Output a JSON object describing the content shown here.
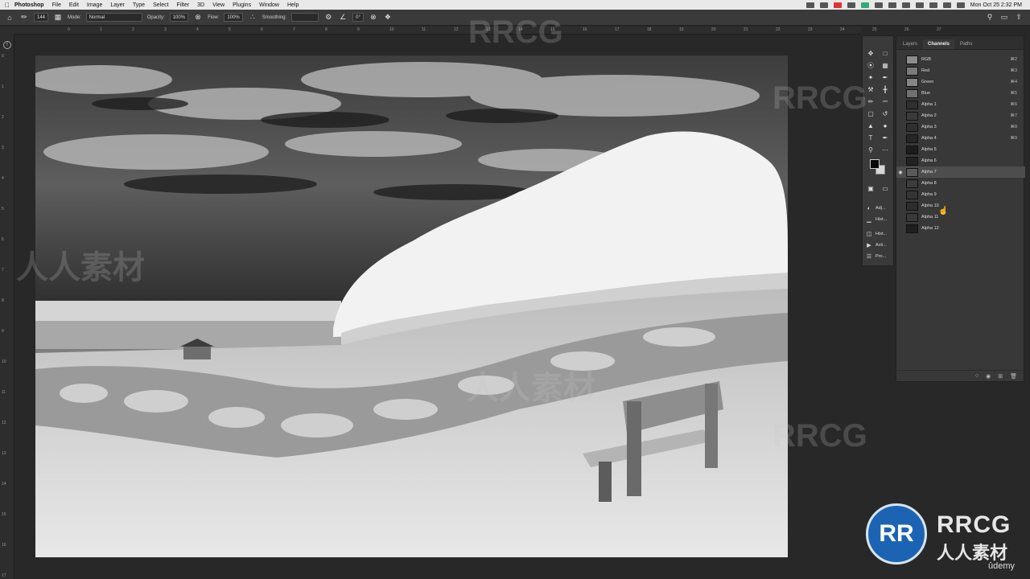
{
  "menubar": {
    "app_name": "Photoshop",
    "menus": [
      "File",
      "Edit",
      "Image",
      "Layer",
      "Type",
      "Select",
      "Filter",
      "3D",
      "View",
      "Plugins",
      "Window",
      "Help"
    ],
    "clock": "Mon Oct 25  2:32 PM"
  },
  "options_bar": {
    "brush_size": "144",
    "mode_label": "Mode:",
    "mode_value": "Normal",
    "opacity_label": "Opacity:",
    "opacity_value": "100%",
    "flow_label": "Flow:",
    "flow_value": "100%",
    "smoothing_label": "Smoothing:",
    "angle_value": "0°"
  },
  "ruler": {
    "ticks": [
      "0",
      "1",
      "2",
      "3",
      "4",
      "5",
      "6",
      "7",
      "8",
      "9",
      "10",
      "11",
      "12",
      "13",
      "14",
      "15",
      "16",
      "17",
      "18",
      "19",
      "20",
      "21",
      "22",
      "23",
      "24",
      "25",
      "26",
      "27"
    ],
    "vticks": [
      "0",
      "1",
      "2",
      "3",
      "4",
      "5",
      "6",
      "7",
      "8",
      "9",
      "10",
      "11",
      "12",
      "13",
      "14",
      "15",
      "16",
      "17"
    ]
  },
  "panel": {
    "tabs": [
      "Layers",
      "Channels",
      "Paths"
    ],
    "active_tab": "Channels",
    "channels": [
      {
        "name": "RGB",
        "shortcut": "⌘2"
      },
      {
        "name": "Red",
        "shortcut": "⌘3"
      },
      {
        "name": "Green",
        "shortcut": "⌘4"
      },
      {
        "name": "Blue",
        "shortcut": "⌘5"
      },
      {
        "name": "Alpha 1",
        "shortcut": "⌘6"
      },
      {
        "name": "Alpha 2",
        "shortcut": "⌘7"
      },
      {
        "name": "Alpha 3",
        "shortcut": "⌘8"
      },
      {
        "name": "Alpha 4",
        "shortcut": "⌘9"
      },
      {
        "name": "Alpha 5",
        "shortcut": ""
      },
      {
        "name": "Alpha 6",
        "shortcut": ""
      },
      {
        "name": "Alpha 7",
        "shortcut": ""
      },
      {
        "name": "Alpha 8",
        "shortcut": ""
      },
      {
        "name": "Alpha 9",
        "shortcut": ""
      },
      {
        "name": "Alpha 10",
        "shortcut": ""
      },
      {
        "name": "Alpha 11",
        "shortcut": ""
      },
      {
        "name": "Alpha 12",
        "shortcut": ""
      }
    ],
    "selected_channel": "Alpha 7"
  },
  "mini_panels": [
    {
      "icon": "adjustments-icon",
      "label": "Adj..."
    },
    {
      "icon": "histogram-icon",
      "label": "Hist..."
    },
    {
      "icon": "history-icon",
      "label": "Hist..."
    },
    {
      "icon": "actions-icon",
      "label": "Acti..."
    },
    {
      "icon": "properties-icon",
      "label": "Pro..."
    }
  ],
  "watermark": {
    "text": "RRCG",
    "subtext": "人人素材",
    "udemy": "ûdemy"
  },
  "colors": {
    "foreground": "#0a0a0a",
    "background": "#d8d8d8",
    "brand_blue": "#1c64b3"
  }
}
